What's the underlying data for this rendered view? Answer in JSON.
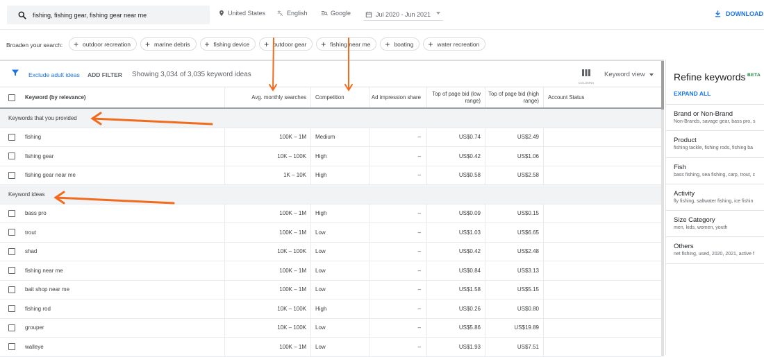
{
  "topbar": {
    "search_query": "fishing, fishing gear, fishing gear near me",
    "location": "United States",
    "language": "English",
    "network": "Google",
    "date_range": "Jul 2020 - Jun 2021",
    "download_label": "DOWNLOAD"
  },
  "broaden": {
    "label": "Broaden your search:",
    "chips": [
      "outdoor recreation",
      "marine debris",
      "fishing device",
      "outdoor gear",
      "fishing near me",
      "boating",
      "water recreation"
    ]
  },
  "filterbar": {
    "exclude_label": "Exclude adult ideas",
    "add_filter_label": "ADD FILTER",
    "showing_text": "Showing 3,034 of 3,035 keyword ideas",
    "columns_label": "COLUMNS",
    "view_label": "Keyword view"
  },
  "table": {
    "headers": {
      "keyword": "Keyword (by relevance)",
      "avg": "Avg. monthly searches",
      "competition": "Competition",
      "impression": "Ad impression share",
      "bid_low": "Top of page bid (low range)",
      "bid_high": "Top of page bid (high range)",
      "account": "Account Status"
    },
    "groups": [
      {
        "title": "Keywords that you provided",
        "rows": [
          {
            "keyword": "fishing",
            "avg": "100K – 1M",
            "competition": "Medium",
            "impression": "–",
            "bid_low": "US$0.74",
            "bid_high": "US$2.49"
          },
          {
            "keyword": "fishing gear",
            "avg": "10K – 100K",
            "competition": "High",
            "impression": "–",
            "bid_low": "US$0.42",
            "bid_high": "US$1.06"
          },
          {
            "keyword": "fishing gear near me",
            "avg": "1K – 10K",
            "competition": "High",
            "impression": "–",
            "bid_low": "US$0.58",
            "bid_high": "US$2.58"
          }
        ]
      },
      {
        "title": "Keyword ideas",
        "rows": [
          {
            "keyword": "bass pro",
            "avg": "100K – 1M",
            "competition": "High",
            "impression": "–",
            "bid_low": "US$0.09",
            "bid_high": "US$0.15"
          },
          {
            "keyword": "trout",
            "avg": "100K – 1M",
            "competition": "Low",
            "impression": "–",
            "bid_low": "US$1.03",
            "bid_high": "US$6.65"
          },
          {
            "keyword": "shad",
            "avg": "10K – 100K",
            "competition": "Low",
            "impression": "–",
            "bid_low": "US$0.42",
            "bid_high": "US$2.48"
          },
          {
            "keyword": "fishing near me",
            "avg": "100K – 1M",
            "competition": "Low",
            "impression": "–",
            "bid_low": "US$0.84",
            "bid_high": "US$3.13"
          },
          {
            "keyword": "bait shop near me",
            "avg": "100K – 1M",
            "competition": "Low",
            "impression": "–",
            "bid_low": "US$1.58",
            "bid_high": "US$5.15"
          },
          {
            "keyword": "fishing rod",
            "avg": "10K – 100K",
            "competition": "High",
            "impression": "–",
            "bid_low": "US$0.26",
            "bid_high": "US$0.80"
          },
          {
            "keyword": "grouper",
            "avg": "10K – 100K",
            "competition": "Low",
            "impression": "–",
            "bid_low": "US$5.86",
            "bid_high": "US$19.89"
          },
          {
            "keyword": "walleye",
            "avg": "100K – 1M",
            "competition": "Low",
            "impression": "–",
            "bid_low": "US$1.93",
            "bid_high": "US$7.51"
          }
        ]
      }
    ]
  },
  "sidebar": {
    "title": "Refine keywords",
    "badge": "BETA",
    "expand_label": "EXPAND ALL",
    "facets": [
      {
        "title": "Brand or Non-Brand",
        "sub": "Non-Brands, savage gear, bass pro, s"
      },
      {
        "title": "Product",
        "sub": "fishing tackle, fishing rods, fishing ba"
      },
      {
        "title": "Fish",
        "sub": "bass fishing, sea fishing, carp, trout, c"
      },
      {
        "title": "Activity",
        "sub": "fly fishing, saltwater fishing, ice fishin"
      },
      {
        "title": "Size Category",
        "sub": "men, kids, women, youth"
      },
      {
        "title": "Others",
        "sub": "net fishing, used, 2020, 2021, active f"
      }
    ]
  },
  "colors": {
    "accent": "#1a73e8",
    "beta": "#188038",
    "annotation": "#f26b1d"
  }
}
